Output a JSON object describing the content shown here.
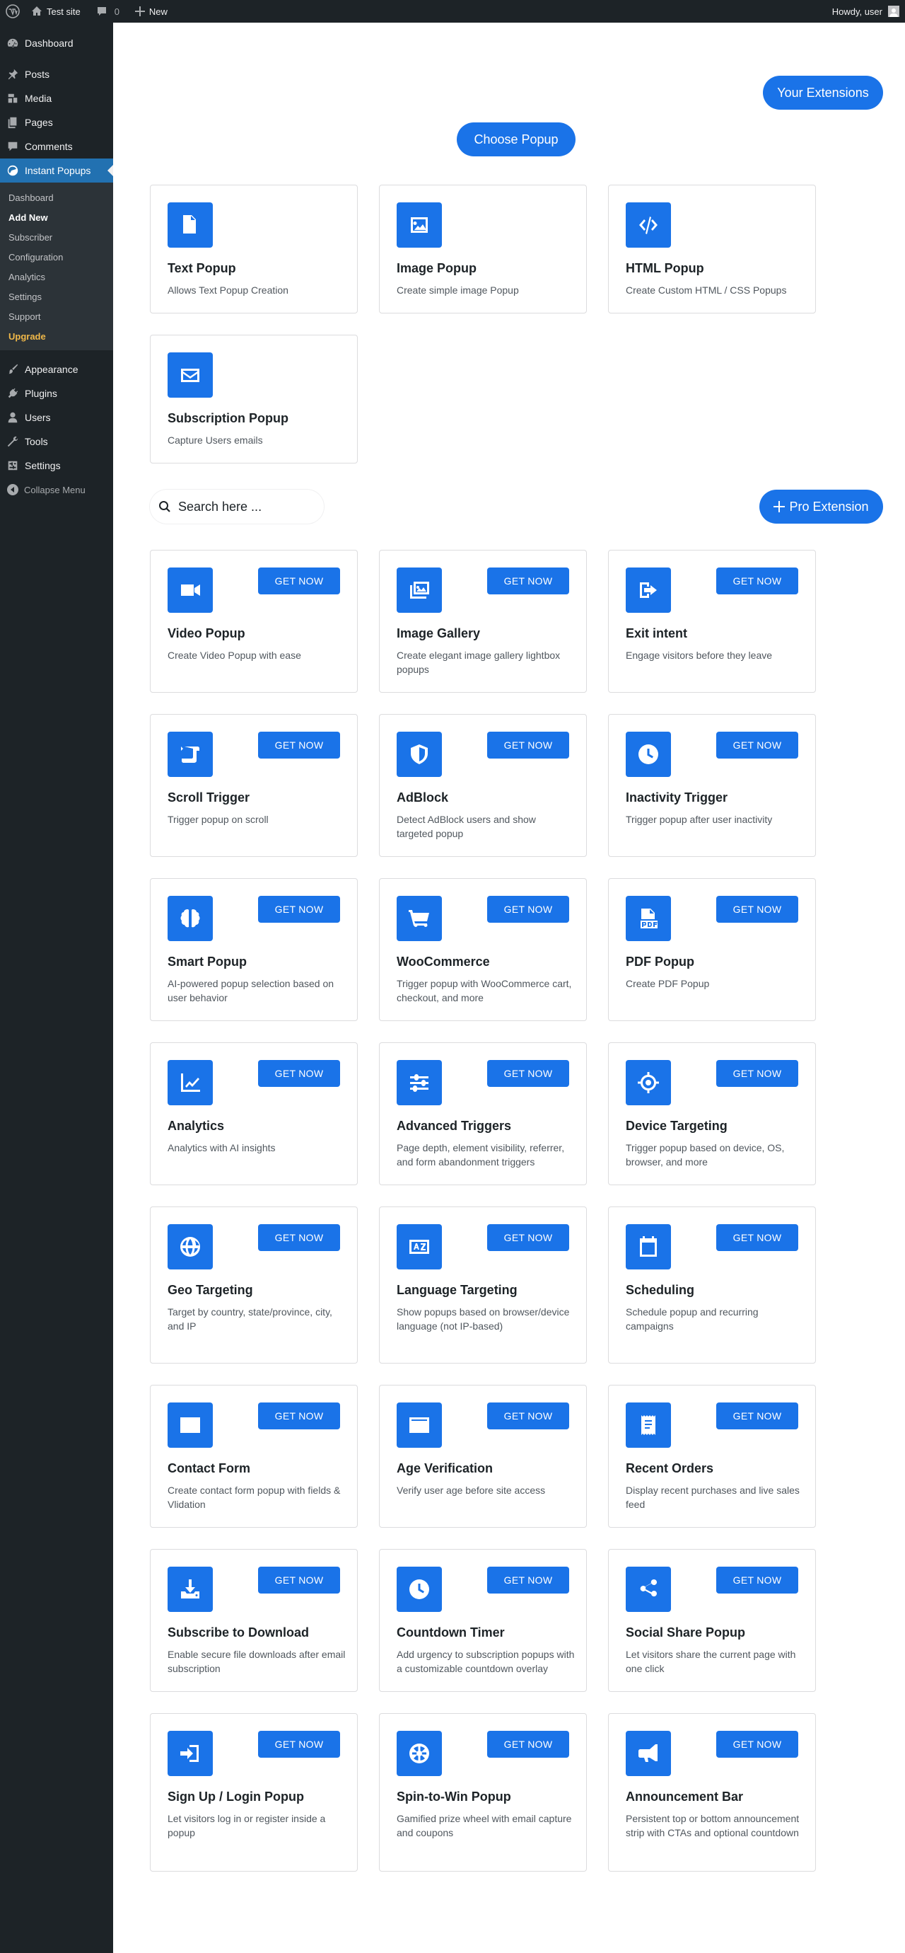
{
  "adminbar": {
    "site_name": "Test site",
    "comments_count": "0",
    "new_label": "New",
    "howdy": "Howdy, user"
  },
  "sidebar": {
    "top": [
      {
        "label": "Dashboard",
        "icon": "dashboard-icon"
      }
    ],
    "group1": [
      {
        "label": "Posts",
        "icon": "pin-icon"
      },
      {
        "label": "Media",
        "icon": "media-icon"
      },
      {
        "label": "Pages",
        "icon": "pages-icon"
      },
      {
        "label": "Comments",
        "icon": "comment-icon"
      },
      {
        "label": "Instant Popups",
        "icon": "popup-icon"
      }
    ],
    "submenu": [
      "Dashboard",
      "Add New",
      "Subscriber",
      "Configuration",
      "Analytics",
      "Settings",
      "Support",
      "Upgrade"
    ],
    "group2": [
      {
        "label": "Appearance",
        "icon": "brush-icon"
      },
      {
        "label": "Plugins",
        "icon": "plug-icon"
      },
      {
        "label": "Users",
        "icon": "users-icon"
      },
      {
        "label": "Tools",
        "icon": "wrench-icon"
      },
      {
        "label": "Settings",
        "icon": "settings-icon"
      }
    ],
    "collapse": "Collapse Menu"
  },
  "main": {
    "your_extensions": "Your Extensions",
    "choose_popup": "Choose Popup",
    "pro_extension": "Pro Extension",
    "search_placeholder": "Search here ...",
    "get_now": "GET NOW",
    "accent": "#1a73e8",
    "basic_popups": [
      {
        "title": "Text Popup",
        "desc": "Allows Text Popup Creation",
        "icon": "document-icon"
      },
      {
        "title": "Image Popup",
        "desc": "Create simple image Popup",
        "icon": "image-icon"
      },
      {
        "title": "HTML Popup",
        "desc": "Create Custom HTML / CSS Popups",
        "icon": "code-icon"
      },
      {
        "title": "Subscription Popup",
        "desc": "Capture Users emails",
        "icon": "envelope-icon"
      }
    ],
    "extensions": [
      {
        "title": "Video Popup",
        "desc": "Create Video Popup with ease",
        "icon": "video-icon"
      },
      {
        "title": "Image Gallery",
        "desc": "Create elegant image gallery lightbox popups",
        "icon": "gallery-icon"
      },
      {
        "title": "Exit intent",
        "desc": "Engage visitors before they leave",
        "icon": "exit-icon"
      },
      {
        "title": "Scroll Trigger",
        "desc": "Trigger popup on scroll",
        "icon": "scroll-icon"
      },
      {
        "title": "AdBlock",
        "desc": "Detect AdBlock users and show targeted popup",
        "icon": "shield-icon"
      },
      {
        "title": "Inactivity Trigger",
        "desc": "Trigger popup after user inactivity",
        "icon": "clock-icon"
      },
      {
        "title": "Smart Popup",
        "desc": "AI-powered popup selection based on user behavior",
        "icon": "brain-icon"
      },
      {
        "title": "WooCommerce",
        "desc": "Trigger popup with WooCommerce cart, checkout, and more",
        "icon": "cart-icon"
      },
      {
        "title": "PDF Popup",
        "desc": "Create PDF Popup",
        "icon": "pdf-icon"
      },
      {
        "title": "Analytics",
        "desc": "Analytics with AI insights",
        "icon": "chart-line-icon"
      },
      {
        "title": "Advanced Triggers",
        "desc": "Page depth, element visibility, referrer, and form abandonment triggers",
        "icon": "sliders-icon"
      },
      {
        "title": "Device Targeting",
        "desc": "Trigger popup based on device, OS, browser, and more",
        "icon": "crosshair-icon"
      },
      {
        "title": "Geo Targeting",
        "desc": "Target by country, state/province, city, and IP",
        "icon": "globe-icon"
      },
      {
        "title": "Language Targeting",
        "desc": "Show popups based on browser/device language (not IP-based)",
        "icon": "language-icon"
      },
      {
        "title": "Scheduling",
        "desc": "Schedule popup and recurring campaigns",
        "icon": "calendar-icon"
      },
      {
        "title": "Contact Form",
        "desc": "Create contact form popup with fields & Vlidation",
        "icon": "contact-card-icon"
      },
      {
        "title": "Age Verification",
        "desc": "Verify user age before site access",
        "icon": "id-card-icon"
      },
      {
        "title": "Recent Orders",
        "desc": "Display recent purchases and live sales feed",
        "icon": "receipt-icon"
      },
      {
        "title": "Subscribe to Download",
        "desc": "Enable secure file downloads after email subscription",
        "icon": "download-icon"
      },
      {
        "title": "Countdown Timer",
        "desc": "Add urgency to subscription popups with a customizable countdown overlay",
        "icon": "timer-icon"
      },
      {
        "title": "Social Share Popup",
        "desc": "Let visitors share the current page with one click",
        "icon": "share-icon"
      },
      {
        "title": "Sign Up / Login Popup",
        "desc": "Let visitors log in or register inside a popup",
        "icon": "login-icon"
      },
      {
        "title": "Spin-to-Win Popup",
        "desc": "Gamified prize wheel with email capture and coupons",
        "icon": "wheel-icon"
      },
      {
        "title": "Announcement Bar",
        "desc": "Persistent top or bottom announcement strip with CTAs and optional countdown",
        "icon": "megaphone-icon"
      }
    ]
  }
}
